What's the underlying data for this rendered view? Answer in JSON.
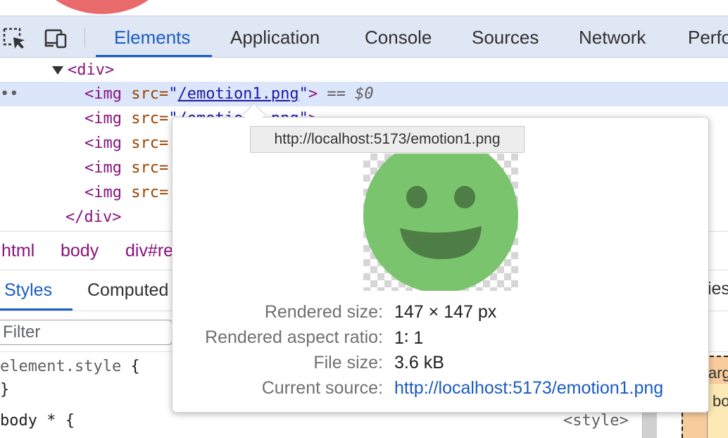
{
  "toolbar": {
    "icons": [
      "inspect-element-icon",
      "device-toolbar-icon"
    ],
    "tabs": [
      {
        "label": "Elements",
        "active": true
      },
      {
        "label": "Application"
      },
      {
        "label": "Console"
      },
      {
        "label": "Sources"
      },
      {
        "label": "Network"
      },
      {
        "label": "Perfo"
      }
    ]
  },
  "dom": {
    "open_div": "<div>",
    "lines": [
      {
        "tag": "<img",
        "attr": " src=",
        "q1": "\"",
        "src": "/emotion1.png",
        "q2": "\"",
        "close": ">",
        "eq": " == ",
        "var": "$0"
      },
      {
        "tag": "<img",
        "attr": " src=",
        "q1": "\"",
        "src": "/emotion2.png",
        "q2": "\"",
        "close": ">"
      },
      {
        "tag": "<img",
        "attr": " src="
      },
      {
        "tag": "<img",
        "attr": " src="
      },
      {
        "tag": "<img",
        "attr": " src="
      }
    ],
    "close_div": "</div>",
    "ellipsis": "••"
  },
  "breadcrumb": [
    "html",
    "body",
    "div#re"
  ],
  "styles": {
    "tabs": [
      "Styles",
      "Computed"
    ],
    "right_tab_edge": "ties",
    "filter_placeholder": "Filter",
    "rules": [
      {
        "selector": "element.style",
        "brace": " {"
      },
      {
        "selector": "}"
      },
      {
        "selector": "body * {"
      }
    ],
    "source": "<style>",
    "box_model_edge": [
      "argi",
      "bo"
    ]
  },
  "popover": {
    "url_tooltip": "http://localhost:5173/emotion1.png",
    "rendered_size_label": "Rendered size:",
    "rendered_size_value": "147 × 147 px",
    "aspect_label": "Rendered aspect ratio:",
    "aspect_value": "1∶ 1",
    "file_size_label": "File size:",
    "file_size_value": "3.6 kB",
    "source_label": "Current source:",
    "source_value": "http://localhost:5173/emotion1.png"
  },
  "colors": {
    "accent": "#1a5bc4",
    "toolbar_bg": "#dfe7f4",
    "selected_row": "#dbe6fb",
    "smiley_face": "#7bc46e",
    "smiley_features": "#4e7d46"
  }
}
